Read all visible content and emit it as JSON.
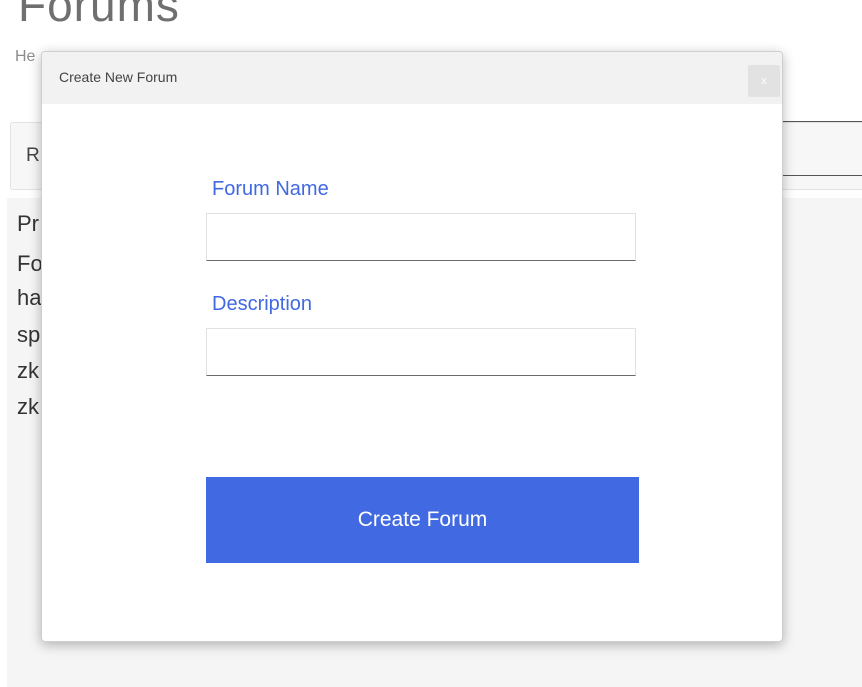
{
  "background": {
    "title": "Forums",
    "subtitle_partial": "He",
    "toolbar_partial": "R",
    "list_items_partial": [
      "Pr",
      "Fo",
      "ha",
      "sp",
      "zk",
      "zk"
    ]
  },
  "modal": {
    "title": "Create New Forum",
    "close_label": "x",
    "fields": [
      {
        "label": "Forum Name",
        "value": "",
        "placeholder": ""
      },
      {
        "label": "Description",
        "value": "",
        "placeholder": ""
      }
    ],
    "submit_label": "Create Forum"
  },
  "colors": {
    "accent": "#4169e1",
    "modal_header": "#f2f2f2"
  }
}
